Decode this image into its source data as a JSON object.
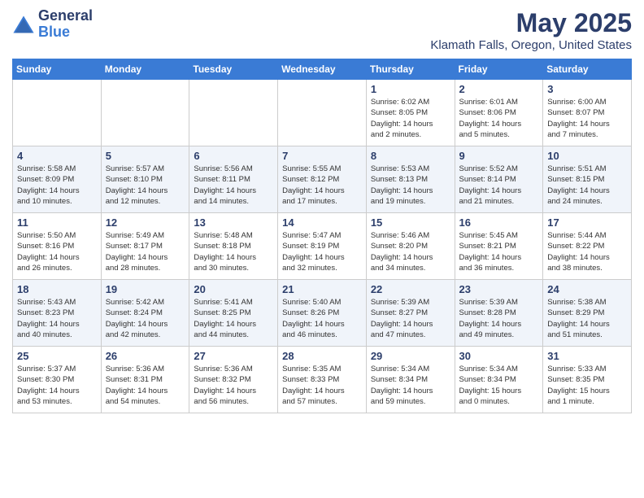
{
  "header": {
    "logo_general": "General",
    "logo_blue": "Blue",
    "title": "May 2025",
    "subtitle": "Klamath Falls, Oregon, United States"
  },
  "days_of_week": [
    "Sunday",
    "Monday",
    "Tuesday",
    "Wednesday",
    "Thursday",
    "Friday",
    "Saturday"
  ],
  "weeks": [
    [
      {
        "num": "",
        "info": ""
      },
      {
        "num": "",
        "info": ""
      },
      {
        "num": "",
        "info": ""
      },
      {
        "num": "",
        "info": ""
      },
      {
        "num": "1",
        "info": "Sunrise: 6:02 AM\nSunset: 8:05 PM\nDaylight: 14 hours\nand 2 minutes."
      },
      {
        "num": "2",
        "info": "Sunrise: 6:01 AM\nSunset: 8:06 PM\nDaylight: 14 hours\nand 5 minutes."
      },
      {
        "num": "3",
        "info": "Sunrise: 6:00 AM\nSunset: 8:07 PM\nDaylight: 14 hours\nand 7 minutes."
      }
    ],
    [
      {
        "num": "4",
        "info": "Sunrise: 5:58 AM\nSunset: 8:09 PM\nDaylight: 14 hours\nand 10 minutes."
      },
      {
        "num": "5",
        "info": "Sunrise: 5:57 AM\nSunset: 8:10 PM\nDaylight: 14 hours\nand 12 minutes."
      },
      {
        "num": "6",
        "info": "Sunrise: 5:56 AM\nSunset: 8:11 PM\nDaylight: 14 hours\nand 14 minutes."
      },
      {
        "num": "7",
        "info": "Sunrise: 5:55 AM\nSunset: 8:12 PM\nDaylight: 14 hours\nand 17 minutes."
      },
      {
        "num": "8",
        "info": "Sunrise: 5:53 AM\nSunset: 8:13 PM\nDaylight: 14 hours\nand 19 minutes."
      },
      {
        "num": "9",
        "info": "Sunrise: 5:52 AM\nSunset: 8:14 PM\nDaylight: 14 hours\nand 21 minutes."
      },
      {
        "num": "10",
        "info": "Sunrise: 5:51 AM\nSunset: 8:15 PM\nDaylight: 14 hours\nand 24 minutes."
      }
    ],
    [
      {
        "num": "11",
        "info": "Sunrise: 5:50 AM\nSunset: 8:16 PM\nDaylight: 14 hours\nand 26 minutes."
      },
      {
        "num": "12",
        "info": "Sunrise: 5:49 AM\nSunset: 8:17 PM\nDaylight: 14 hours\nand 28 minutes."
      },
      {
        "num": "13",
        "info": "Sunrise: 5:48 AM\nSunset: 8:18 PM\nDaylight: 14 hours\nand 30 minutes."
      },
      {
        "num": "14",
        "info": "Sunrise: 5:47 AM\nSunset: 8:19 PM\nDaylight: 14 hours\nand 32 minutes."
      },
      {
        "num": "15",
        "info": "Sunrise: 5:46 AM\nSunset: 8:20 PM\nDaylight: 14 hours\nand 34 minutes."
      },
      {
        "num": "16",
        "info": "Sunrise: 5:45 AM\nSunset: 8:21 PM\nDaylight: 14 hours\nand 36 minutes."
      },
      {
        "num": "17",
        "info": "Sunrise: 5:44 AM\nSunset: 8:22 PM\nDaylight: 14 hours\nand 38 minutes."
      }
    ],
    [
      {
        "num": "18",
        "info": "Sunrise: 5:43 AM\nSunset: 8:23 PM\nDaylight: 14 hours\nand 40 minutes."
      },
      {
        "num": "19",
        "info": "Sunrise: 5:42 AM\nSunset: 8:24 PM\nDaylight: 14 hours\nand 42 minutes."
      },
      {
        "num": "20",
        "info": "Sunrise: 5:41 AM\nSunset: 8:25 PM\nDaylight: 14 hours\nand 44 minutes."
      },
      {
        "num": "21",
        "info": "Sunrise: 5:40 AM\nSunset: 8:26 PM\nDaylight: 14 hours\nand 46 minutes."
      },
      {
        "num": "22",
        "info": "Sunrise: 5:39 AM\nSunset: 8:27 PM\nDaylight: 14 hours\nand 47 minutes."
      },
      {
        "num": "23",
        "info": "Sunrise: 5:39 AM\nSunset: 8:28 PM\nDaylight: 14 hours\nand 49 minutes."
      },
      {
        "num": "24",
        "info": "Sunrise: 5:38 AM\nSunset: 8:29 PM\nDaylight: 14 hours\nand 51 minutes."
      }
    ],
    [
      {
        "num": "25",
        "info": "Sunrise: 5:37 AM\nSunset: 8:30 PM\nDaylight: 14 hours\nand 53 minutes."
      },
      {
        "num": "26",
        "info": "Sunrise: 5:36 AM\nSunset: 8:31 PM\nDaylight: 14 hours\nand 54 minutes."
      },
      {
        "num": "27",
        "info": "Sunrise: 5:36 AM\nSunset: 8:32 PM\nDaylight: 14 hours\nand 56 minutes."
      },
      {
        "num": "28",
        "info": "Sunrise: 5:35 AM\nSunset: 8:33 PM\nDaylight: 14 hours\nand 57 minutes."
      },
      {
        "num": "29",
        "info": "Sunrise: 5:34 AM\nSunset: 8:34 PM\nDaylight: 14 hours\nand 59 minutes."
      },
      {
        "num": "30",
        "info": "Sunrise: 5:34 AM\nSunset: 8:34 PM\nDaylight: 15 hours\nand 0 minutes."
      },
      {
        "num": "31",
        "info": "Sunrise: 5:33 AM\nSunset: 8:35 PM\nDaylight: 15 hours\nand 1 minute."
      }
    ]
  ]
}
